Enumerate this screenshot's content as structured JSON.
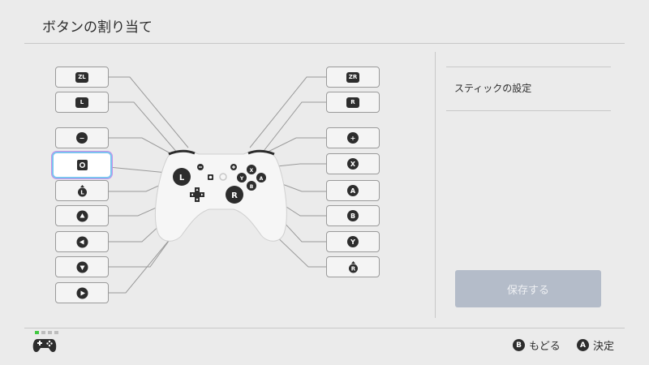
{
  "header": {
    "title": "ボタンの割り当て"
  },
  "left_buttons": [
    {
      "name": "zl",
      "glyph": "ZL"
    },
    {
      "name": "l",
      "glyph": "L"
    },
    {
      "name": "minus",
      "glyph": "−"
    },
    {
      "name": "capture",
      "glyph": "capture"
    },
    {
      "name": "left-stick",
      "glyph": "stick-L"
    },
    {
      "name": "up",
      "glyph": "up"
    },
    {
      "name": "left",
      "glyph": "left"
    },
    {
      "name": "down",
      "glyph": "down"
    },
    {
      "name": "right",
      "glyph": "right"
    }
  ],
  "right_buttons": [
    {
      "name": "zr",
      "glyph": "ZR"
    },
    {
      "name": "r",
      "glyph": "R"
    },
    {
      "name": "plus",
      "glyph": "+"
    },
    {
      "name": "x",
      "glyph": "X"
    },
    {
      "name": "a",
      "glyph": "A"
    },
    {
      "name": "b",
      "glyph": "B"
    },
    {
      "name": "y",
      "glyph": "Y"
    },
    {
      "name": "right-stick",
      "glyph": "stick-R"
    }
  ],
  "controller": {
    "l": "L",
    "r": "R",
    "x": "X",
    "y": "Y",
    "a": "A",
    "b": "B"
  },
  "sidebar": {
    "stick_settings_label": "スティックの設定"
  },
  "save_button": {
    "label": "保存する"
  },
  "footer": {
    "back": {
      "key": "B",
      "label": "もどる"
    },
    "confirm": {
      "key": "A",
      "label": "決定"
    }
  },
  "colors": {
    "background": "#ebebeb",
    "save_disabled": "#b4bcc9",
    "page_indicator_active": "#40c840",
    "selection_glow": "#7cc4ef"
  },
  "icons": {
    "controller": "gamepad-icon"
  }
}
